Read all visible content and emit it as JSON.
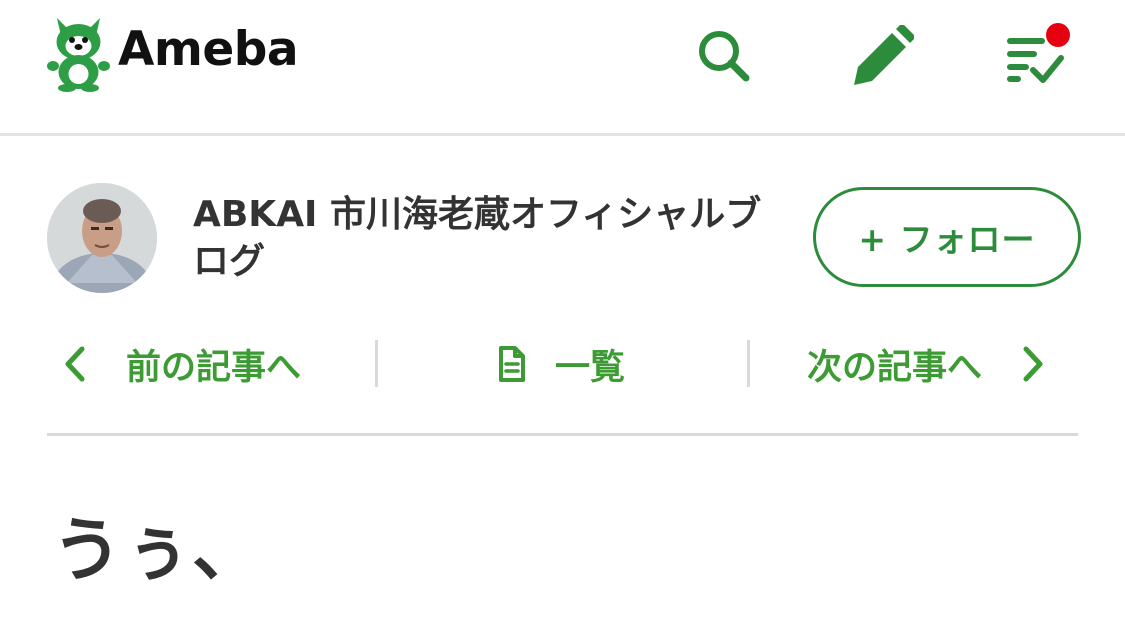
{
  "header": {
    "logo_text": "Ameba",
    "brand_color": "#2d8c3c",
    "notification_color": "#e7000f",
    "icons": [
      "ameba-logo-icon",
      "search-icon",
      "pen-icon",
      "notification-list-icon"
    ]
  },
  "profile": {
    "blog_title": "ABKAI 市川海老蔵オフィシャルブログ",
    "follow_label": "+ フォロー"
  },
  "nav": {
    "prev_label": "前の記事へ",
    "list_label": "一覧",
    "next_label": "次の記事へ",
    "accent_color": "#3d9b34"
  },
  "article": {
    "title": "うぅ、"
  }
}
